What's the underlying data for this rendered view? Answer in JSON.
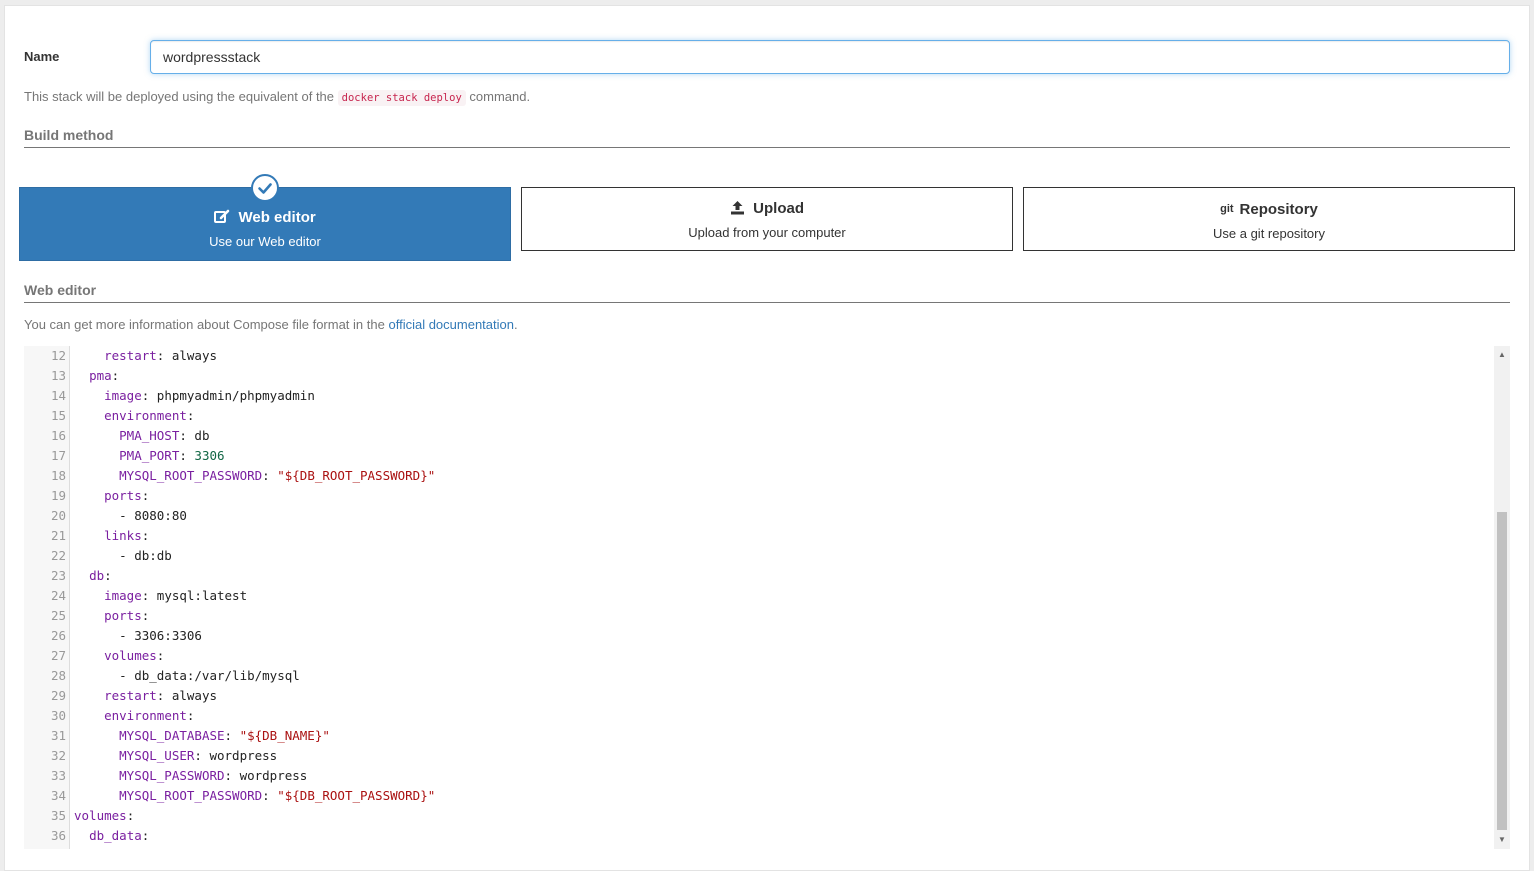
{
  "name_field": {
    "label": "Name",
    "value": "wordpressstack"
  },
  "help": {
    "prefix": "This stack will be deployed using the equivalent of the",
    "code": "docker stack deploy",
    "suffix": "command."
  },
  "build_method": {
    "section_title": "Build method",
    "options": [
      {
        "title": "Web editor",
        "subtitle": "Use our Web editor",
        "icon": "edit-icon",
        "selected": true
      },
      {
        "title": "Upload",
        "subtitle": "Upload from your computer",
        "icon": "upload-icon",
        "selected": false
      },
      {
        "title": "Repository",
        "subtitle": "Use a git repository",
        "icon": "git-icon",
        "icon_text": "git",
        "selected": false
      }
    ]
  },
  "web_editor": {
    "section_title": "Web editor",
    "info_prefix": "You can get more information about Compose file format in the",
    "info_link": "official documentation",
    "info_suffix": "."
  },
  "editor": {
    "lines": [
      {
        "n": "12",
        "text": "    restart: always"
      },
      {
        "n": "13",
        "text": "  pma:"
      },
      {
        "n": "14",
        "text": "    image: phpmyadmin/phpmyadmin"
      },
      {
        "n": "15",
        "text": "    environment:"
      },
      {
        "n": "16",
        "text": "      PMA_HOST: db"
      },
      {
        "n": "17",
        "text": "      PMA_PORT: 3306"
      },
      {
        "n": "18",
        "text": "      MYSQL_ROOT_PASSWORD: \"${DB_ROOT_PASSWORD}\""
      },
      {
        "n": "19",
        "text": "    ports:"
      },
      {
        "n": "20",
        "text": "      - 8080:80"
      },
      {
        "n": "21",
        "text": "    links:"
      },
      {
        "n": "22",
        "text": "      - db:db"
      },
      {
        "n": "23",
        "text": "  db:"
      },
      {
        "n": "24",
        "text": "    image: mysql:latest"
      },
      {
        "n": "25",
        "text": "    ports:"
      },
      {
        "n": "26",
        "text": "      - 3306:3306"
      },
      {
        "n": "27",
        "text": "    volumes:"
      },
      {
        "n": "28",
        "text": "      - db_data:/var/lib/mysql"
      },
      {
        "n": "29",
        "text": "    restart: always"
      },
      {
        "n": "30",
        "text": "    environment:"
      },
      {
        "n": "31",
        "text": "      MYSQL_DATABASE: \"${DB_NAME}\""
      },
      {
        "n": "32",
        "text": "      MYSQL_USER: wordpress"
      },
      {
        "n": "33",
        "text": "      MYSQL_PASSWORD: wordpress"
      },
      {
        "n": "34",
        "text": "      MYSQL_ROOT_PASSWORD: \"${DB_ROOT_PASSWORD}\""
      },
      {
        "n": "35",
        "text": "volumes:"
      },
      {
        "n": "36",
        "text": "  db_data:"
      }
    ]
  },
  "colors": {
    "primary": "#337ab7",
    "help_text": "#767676",
    "code_string": "#aa1111",
    "code_key": "#7a1fa0"
  }
}
